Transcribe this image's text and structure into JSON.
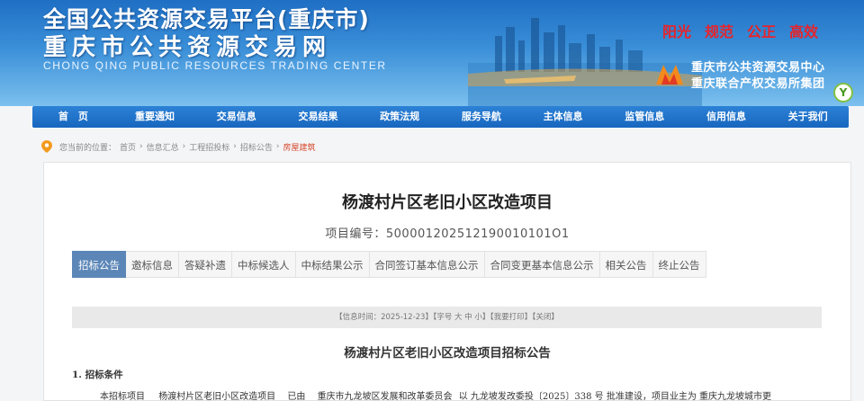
{
  "header": {
    "title_line1": "全国公共资源交易平台(重庆市)",
    "title_line2": "重庆市公共资源交易网",
    "title_en": "CHONG QING PUBLIC RESOURCES TRADING CENTER",
    "slogans": [
      "阳光",
      "规范",
      "公正",
      "高效"
    ],
    "org_line1": "重庆市公共资源交易中心",
    "org_line2": "重庆联合产权交易所集团",
    "badge": "Y"
  },
  "nav": [
    "首　页",
    "重要通知",
    "交易信息",
    "交易结果",
    "政策法规",
    "服务导航",
    "主体信息",
    "监管信息",
    "信用信息",
    "关于我们"
  ],
  "breadcrumb": {
    "prefix": "您当前的位置：",
    "items": [
      "首页",
      "信息汇总",
      "工程招投标",
      "招标公告"
    ],
    "current": "房屋建筑",
    "sep": "›"
  },
  "project": {
    "title": "杨渡村片区老旧小区改造项目",
    "code": "项目编号：500001202512190010101O1"
  },
  "tabs": [
    "招标公告",
    "邀标信息",
    "答疑补遗",
    "中标候选人",
    "中标结果公示",
    "合同签订基本信息公示",
    "合同变更基本信息公示",
    "相关公告",
    "终止公告"
  ],
  "info_bar": {
    "time": "【信息时间：2025-12-23】",
    "font": "【字号",
    "sizes": [
      "大",
      "中",
      "小"
    ],
    "font_end": "】",
    "print": "【我要打印】",
    "close": "【关闭】"
  },
  "announcement": {
    "title": "杨渡村片区老旧小区改造项目招标公告",
    "section1": "1. 招标条件",
    "para_lead": "本招标项目",
    "para_project": "杨渡村片区老旧小区改造项目",
    "para_by": "已由",
    "para_authority": "重庆市九龙坡区发展和改革委员会",
    "para_rest": "以 九龙坡发改委投〔2025〕338 号 批准建设，项目业主为 重庆九龙坡城市更"
  },
  "colors": {
    "nav": "#1d6cc4",
    "tab_active": "#5b86b7",
    "slogan": "#e8232a",
    "current_crumb": "#d6472b"
  }
}
